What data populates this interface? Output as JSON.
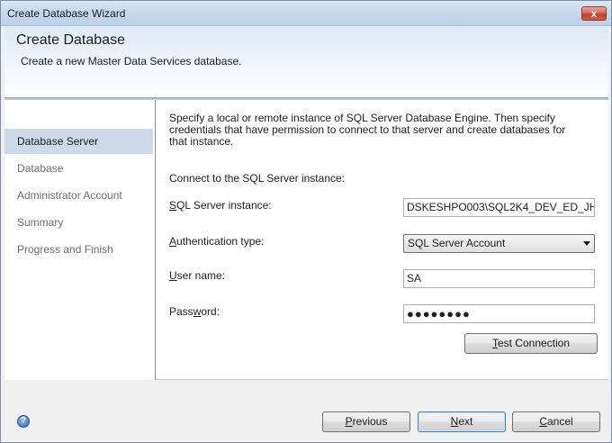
{
  "window": {
    "title": "Create Database Wizard",
    "close_label": "x"
  },
  "header": {
    "title": "Create Database",
    "subtitle": "Create a new Master Data Services database."
  },
  "nav": {
    "items": [
      {
        "label": "Database Server",
        "active": true
      },
      {
        "label": "Database",
        "active": false
      },
      {
        "label": "Administrator Account",
        "active": false
      },
      {
        "label": "Summary",
        "active": false
      },
      {
        "label": "Progress and Finish",
        "active": false
      }
    ]
  },
  "content": {
    "description": "Specify a local or remote instance of SQL Server Database Engine. Then specify credentials that have permission to connect to that server and create databases for that instance.",
    "connect_label": "Connect to the SQL Server instance:",
    "fields": {
      "instance": {
        "label_accel": "S",
        "label_rest": "QL Server instance:",
        "value": "DSKESHPO003\\SQL2K4_DEV_ED_JH"
      },
      "auth": {
        "label_accel": "A",
        "label_rest": "uthentication type:",
        "value": "SQL Server Account"
      },
      "user": {
        "label_accel": "U",
        "label_rest": "ser name:",
        "value": "SA"
      },
      "password": {
        "label_pre": "Pass",
        "label_accel": "w",
        "label_rest": "ord:",
        "value": "●●●●●●●●"
      }
    },
    "test_connection": {
      "accel": "T",
      "rest": "est Connection"
    }
  },
  "footer": {
    "help_icon": "?",
    "previous": {
      "accel": "P",
      "rest": "revious"
    },
    "next": {
      "accel": "N",
      "rest": "ext"
    },
    "cancel": {
      "accel": "C",
      "rest": "ancel"
    }
  }
}
